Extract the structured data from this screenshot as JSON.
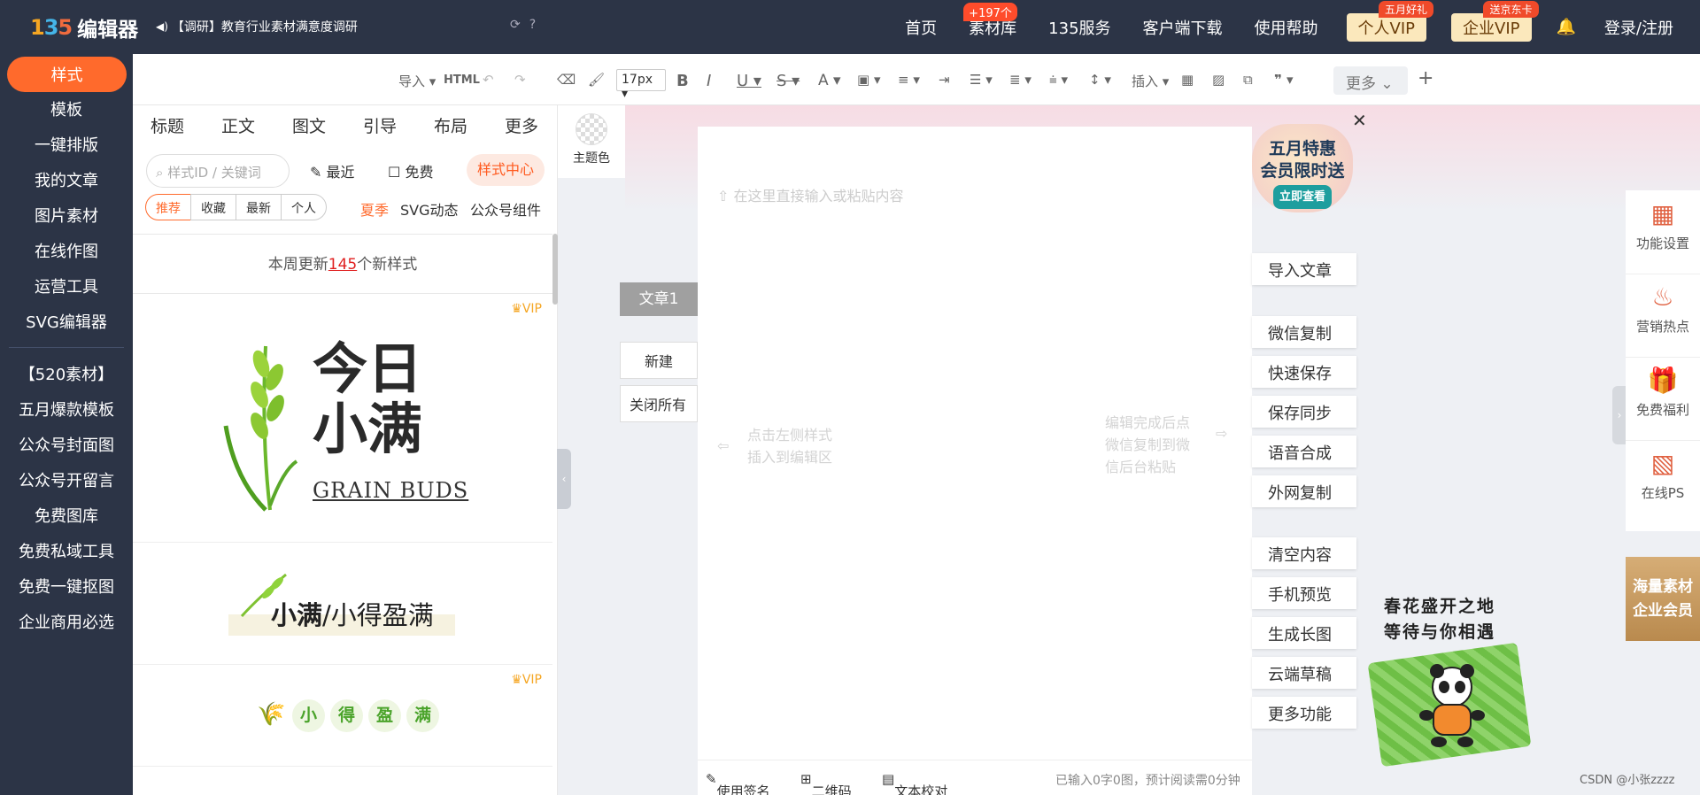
{
  "app": {
    "logo_text": "编辑器"
  },
  "topbar": {
    "notice": "【调研】教育行业素材满意度调研",
    "nav": [
      {
        "label": "首页"
      },
      {
        "label": "素材库",
        "badge": "+197个"
      },
      {
        "label": "135服务"
      },
      {
        "label": "客户端下载"
      },
      {
        "label": "使用帮助"
      }
    ],
    "vip_personal": {
      "label": "个人VIP",
      "tag": "五月好礼"
    },
    "vip_enterprise": {
      "label": "企业VIP",
      "tag": "送京东卡"
    },
    "login": "登录/注册"
  },
  "sidebar": {
    "active": "样式",
    "items": [
      "模板",
      "一键排版",
      "我的文章",
      "图片素材",
      "在线作图",
      "运营工具",
      "SVG编辑器"
    ],
    "items2": [
      "【520素材】",
      "五月爆款模板",
      "公众号封面图",
      "公众号开留言",
      "免费图库",
      "免费私域工具",
      "免费一键抠图",
      "企业商用必选"
    ]
  },
  "toolbar": {
    "import": "导入",
    "html": "HTML",
    "font_size": "17px",
    "insert": "插入",
    "more": "更多"
  },
  "panel": {
    "tabs": [
      "标题",
      "正文",
      "图文",
      "引导",
      "布局",
      "更多"
    ],
    "search_placeholder": "样式ID / 关键词",
    "recent": "最近",
    "free": "免费",
    "style_center": "样式中心",
    "filters": [
      "推荐",
      "收藏",
      "最新",
      "个人"
    ],
    "tags": [
      "夏季",
      "SVG动态",
      "公众号组件"
    ],
    "weekly_prefix": "本周更新",
    "weekly_num": "145",
    "weekly_suffix": "个新样式",
    "vip": "VIP",
    "card1": {
      "line1": "今日",
      "line2": "小满",
      "sub": "GRAIN BUDS"
    },
    "card2": {
      "bold": "小满",
      "rest": "/小得盈满"
    },
    "card3": [
      "小",
      "得",
      "盈",
      "满"
    ]
  },
  "theme": {
    "label": "主题色"
  },
  "articles": {
    "active": "文章1",
    "new": "新建",
    "close_all": "关闭所有"
  },
  "editor": {
    "placeholder": "在这里直接输入或粘贴内容",
    "hint_left_1": "点击左侧样式",
    "hint_left_2": "插入到编辑区",
    "hint_right_1": "编辑完成后点",
    "hint_right_2": "微信复制到微",
    "hint_right_3": "信后台粘贴",
    "footer": {
      "signature": "使用签名",
      "qrcode": "二维码",
      "proofread": "文本校对",
      "stats": "已输入0字0图，预计阅读需0分钟"
    }
  },
  "promo": {
    "line1": "五月特惠",
    "line2": "会员限时送",
    "cta": "立即查看"
  },
  "actions": {
    "group1": [
      "导入文章"
    ],
    "group2": [
      "微信复制",
      "快速保存",
      "保存同步",
      "语音合成",
      "外网复制"
    ],
    "group3": [
      "清空内容",
      "手机预览",
      "生成长图",
      "云端草稿",
      "更多功能"
    ]
  },
  "right_panel": {
    "items": [
      "功能设置",
      "营销热点",
      "免费福利",
      "在线PS"
    ],
    "vip_line1": "海量素材",
    "vip_line2": "企业会员"
  },
  "panda": {
    "line1": "春花盛开之地",
    "line2": "等待与你相遇"
  },
  "watermark": "CSDN @小张zzzz"
}
